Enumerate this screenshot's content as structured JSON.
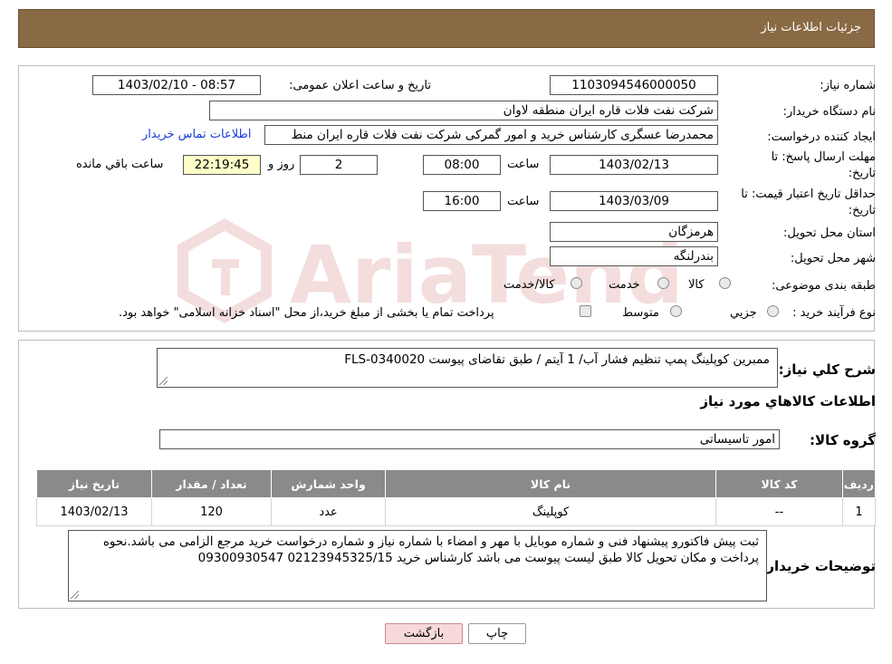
{
  "header": {
    "title": "جزئیات اطلاعات نیاز"
  },
  "form": {
    "need_number": {
      "label": "شماره نیاز:",
      "value": "1103094546000050"
    },
    "announce": {
      "label": "تاریخ و ساعت اعلان عمومی:",
      "value": "1403/02/10 - 08:57"
    },
    "buyer_org": {
      "label": "نام دستگاه خریدار:",
      "value": "شرکت نفت فلات قاره ایران منطقه لاوان"
    },
    "requester": {
      "label": "ایجاد کننده درخواست:",
      "value": "محمدرضا عسگری کارشناس خرید و امور گمرکی شرکت نفت فلات قاره ایران منط",
      "contact_link": "اطلاعات تماس خریدار"
    },
    "deadline": {
      "label_line1": "مهلت ارسال پاسخ: تا",
      "label_line2": "تاریخ:",
      "date": "1403/02/13",
      "time_label": "ساعت",
      "time": "08:00",
      "days": "2",
      "days_label": "روز و",
      "remaining": "22:19:45",
      "remaining_label": "ساعت باقي مانده"
    },
    "validity": {
      "label_line1": "حداقل تاریخ اعتبار قیمت: تا",
      "label_line2": "تاریخ:",
      "date": "1403/03/09",
      "time_label": "ساعت",
      "time": "16:00"
    },
    "province": {
      "label": "استان محل تحویل:",
      "value": "هرمزگان"
    },
    "city": {
      "label": "شهر محل تحویل:",
      "value": "بندرلنگه"
    },
    "category": {
      "label": "طبقه بندی موضوعی:",
      "options": [
        "کالا",
        "خدمت",
        "کالا/خدمت"
      ]
    },
    "process": {
      "label": "نوع فرآیند خرید :",
      "options": [
        "جزيي",
        "متوسط"
      ],
      "note": "پرداخت تمام یا بخشی از مبلغ خرید،از محل \"اسناد خزانه اسلامی\" خواهد بود."
    }
  },
  "details": {
    "summary_label": "شرح کلي نياز:",
    "summary_value": "ممبرین کوپلینگ پمپ تنظیم فشار آب/ 1 آیتم / طبق تقاضای پیوست FLS-0340020",
    "goods_info_title": "اطلاعات کالاهاي مورد نياز",
    "group_label": "گروه کالا:",
    "group_value": "امور تاسیساتی"
  },
  "table": {
    "headers": [
      "رديف",
      "کد کالا",
      "نام کالا",
      "واحد شمارش",
      "تعداد / مقدار",
      "تاريخ نياز"
    ],
    "rows": [
      [
        "1",
        "--",
        "کوپلینگ",
        "عدد",
        "120",
        "1403/02/13"
      ]
    ]
  },
  "buyer_notes": {
    "label": "توضيحات خريدار:",
    "value": "ثبت پیش فاکتورو پیشنهاد فنی و شماره موبایل با مهر و امضاء با شماره نیاز و شماره درخواست خرید مرجع الزامی می باشد.نحوه پرداخت و مکان تحویل کالا طبق لیست پیوست می باشد کارشناس خرید 02123945325/15 09300930547"
  },
  "buttons": {
    "print": "چاپ",
    "back": "بازگشت"
  },
  "colors": {
    "header_bg": "#8a6a44",
    "table_header_bg": "#8a8a8a",
    "link": "#1a3cd6",
    "back_button_bg": "#f7d9d9"
  },
  "watermark": {
    "text": "AriaTender.neT"
  }
}
